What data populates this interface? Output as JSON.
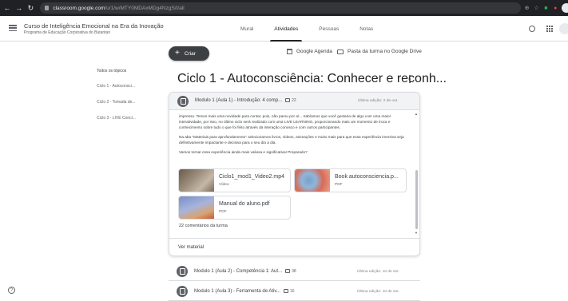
{
  "browser": {
    "url_host": "classroom.google.com",
    "url_path": "/u/1/w/MTY0MDAxMDg4NzgS/t/all"
  },
  "header": {
    "course_title": "Curso de Inteligência Emocional na Era da Inovação",
    "course_subtitle": "Programa de Educação Corporativa do Butantan",
    "tabs": [
      "Mural",
      "Atividades",
      "Pessoas",
      "Notas"
    ],
    "active_tab": "Atividades"
  },
  "toolbar": {
    "create_label": "Criar",
    "calendar_label": "Google Agenda",
    "drive_label": "Pasta da turma no Google Drive"
  },
  "topics": [
    "Todos os tópicos",
    "Ciclo 1 - Autoconsci...",
    "Ciclo 2 - Tomada de...",
    "Ciclo 3 - LIVE Concl..."
  ],
  "section": {
    "title": "Ciclo 1 - Autoconsciência: Conhecer e reconh..."
  },
  "expanded_item": {
    "title": "Modulo 1 (Aula 1) - Introdução: 4 comp...",
    "comment_count": "22",
    "edited": "Última edição: 2 de out.",
    "body": [
      "impresso. Temos mais uma novidade para contar, pois, não parou por aí... Sabíamos que você gostaria de algo com uma maior interatividade, por isso, no último ciclo será realizado com uma LIVE LEARNING, proporcionando mais um momento de troca e conhecimento sobre tudo o que foi feito através da interação conosco e com outros participantes.",
      "Na aba \"Materiais para aprofundamento\" selecionamos livros, vídeos, animações e muito mais para que essa experiência imersiva seja definitivamente impactante e decisiva para o seu dia a dia.",
      "Vamos tornar essa experiência ainda mais valiosa e significativa! Preparado?"
    ],
    "attachments": [
      {
        "name": "Ciclo1_mod1_Video2.mp4",
        "type": "Vídeo"
      },
      {
        "name": "Book autoconsciencia.p...",
        "type": "PDF"
      },
      {
        "name": "Manual do aluno.pdf",
        "type": "PDF"
      }
    ],
    "comments_label": "22 comentários da turma",
    "view_label": "Ver material"
  },
  "other_items": [
    {
      "title": "Modulo 1 (Aula 2) - Competência 1: Aut...",
      "comment_count": "38",
      "edited": "Última edição: 10 de set."
    },
    {
      "title": "Modulo 1 (Aula 3) - Ferramenta de Ativ...",
      "comment_count": "16",
      "edited": "Última edição: 10 de set."
    }
  ]
}
